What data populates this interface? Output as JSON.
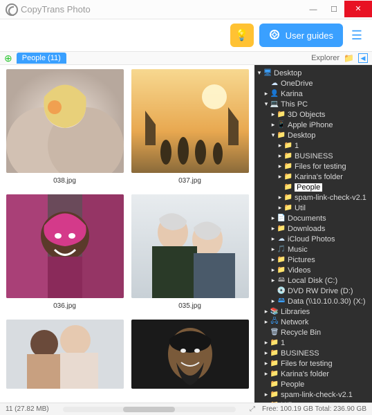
{
  "window": {
    "title": "CopyTrans Photo"
  },
  "toolbar": {
    "guides_label": "User guides"
  },
  "header": {
    "crumb_label": "People (11)",
    "explorer_label": "Explorer"
  },
  "thumbs": [
    {
      "name": "038.jpg"
    },
    {
      "name": "037.jpg"
    },
    {
      "name": "036.jpg"
    },
    {
      "name": "035.jpg"
    },
    {
      "name": ""
    },
    {
      "name": ""
    }
  ],
  "tree": [
    {
      "depth": 0,
      "exp": "▾",
      "icon": "desktop",
      "label": "Desktop"
    },
    {
      "depth": 1,
      "exp": "",
      "icon": "cloud",
      "label": "OneDrive"
    },
    {
      "depth": 1,
      "exp": "▸",
      "icon": "user",
      "label": "Karina"
    },
    {
      "depth": 1,
      "exp": "▾",
      "icon": "pc",
      "label": "This PC"
    },
    {
      "depth": 2,
      "exp": "▸",
      "icon": "folder",
      "label": "3D Objects"
    },
    {
      "depth": 2,
      "exp": "▸",
      "icon": "phone",
      "label": "Apple iPhone"
    },
    {
      "depth": 2,
      "exp": "▾",
      "icon": "folder",
      "label": "Desktop"
    },
    {
      "depth": 3,
      "exp": "▸",
      "icon": "folder",
      "label": "1"
    },
    {
      "depth": 3,
      "exp": "▸",
      "icon": "folder",
      "label": "BUSINESS"
    },
    {
      "depth": 3,
      "exp": "▸",
      "icon": "folder",
      "label": "Files for testing"
    },
    {
      "depth": 3,
      "exp": "▸",
      "icon": "folder",
      "label": "Karina's folder"
    },
    {
      "depth": 3,
      "exp": "",
      "icon": "folder",
      "label": "People",
      "selected": true
    },
    {
      "depth": 3,
      "exp": "▸",
      "icon": "folder",
      "label": "spam-link-check-v2.1"
    },
    {
      "depth": 3,
      "exp": "▸",
      "icon": "folder",
      "label": "Util"
    },
    {
      "depth": 2,
      "exp": "▸",
      "icon": "doc",
      "label": "Documents"
    },
    {
      "depth": 2,
      "exp": "▸",
      "icon": "folder",
      "label": "Downloads"
    },
    {
      "depth": 2,
      "exp": "▸",
      "icon": "cloud",
      "label": "iCloud Photos"
    },
    {
      "depth": 2,
      "exp": "▸",
      "icon": "music",
      "label": "Music"
    },
    {
      "depth": 2,
      "exp": "▸",
      "icon": "folder",
      "label": "Pictures"
    },
    {
      "depth": 2,
      "exp": "▸",
      "icon": "folder",
      "label": "Videos"
    },
    {
      "depth": 2,
      "exp": "▸",
      "icon": "drive",
      "label": "Local Disk (C:)"
    },
    {
      "depth": 2,
      "exp": "",
      "icon": "dvd",
      "label": "DVD RW Drive (D:)"
    },
    {
      "depth": 2,
      "exp": "▸",
      "icon": "netdrive",
      "label": "Data (\\\\10.10.0.30) (X:)"
    },
    {
      "depth": 1,
      "exp": "▸",
      "icon": "lib",
      "label": "Libraries"
    },
    {
      "depth": 1,
      "exp": "▸",
      "icon": "net",
      "label": "Network"
    },
    {
      "depth": 1,
      "exp": "",
      "icon": "bin",
      "label": "Recycle Bin"
    },
    {
      "depth": 1,
      "exp": "▸",
      "icon": "folder",
      "label": "1"
    },
    {
      "depth": 1,
      "exp": "▸",
      "icon": "folder",
      "label": "BUSINESS"
    },
    {
      "depth": 1,
      "exp": "▸",
      "icon": "folder",
      "label": "Files for testing"
    },
    {
      "depth": 1,
      "exp": "▸",
      "icon": "folder",
      "label": "Karina's folder"
    },
    {
      "depth": 1,
      "exp": "",
      "icon": "folder",
      "label": "People"
    },
    {
      "depth": 1,
      "exp": "▸",
      "icon": "folder",
      "label": "spam-link-check-v2.1"
    },
    {
      "depth": 1,
      "exp": "▸",
      "icon": "folder",
      "label": "Util"
    }
  ],
  "status": {
    "left": "11 (27.82 MB)",
    "right": "Free: 100.19 GB Total: 236.90 GB"
  }
}
